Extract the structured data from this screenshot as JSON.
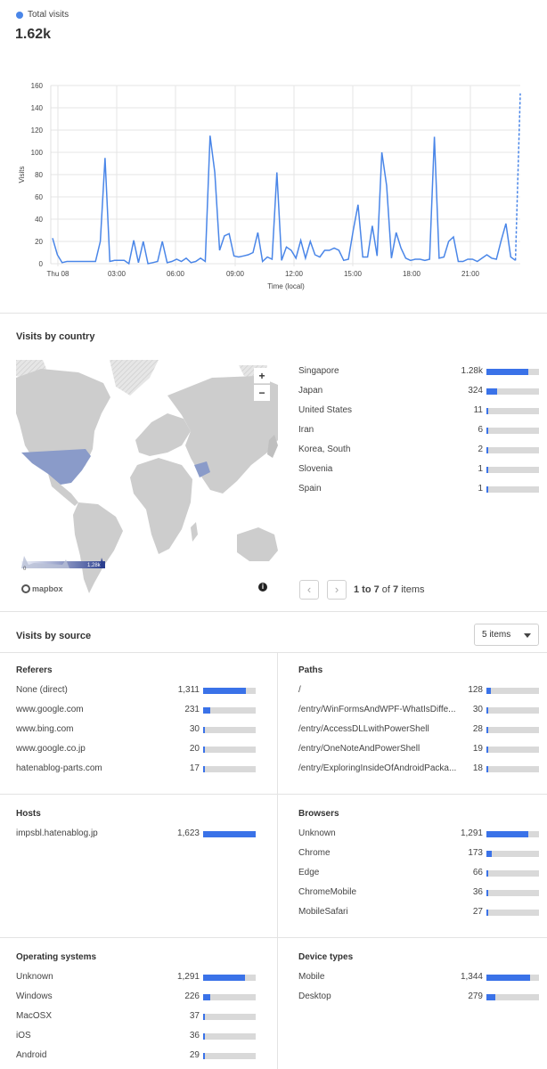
{
  "header": {
    "legend_label": "Total visits",
    "total": "1.62k",
    "accent": "#4a86e8"
  },
  "chart_data": {
    "type": "line",
    "title": "",
    "ylabel": "Visits",
    "xlabel": "Time (local)",
    "ylim": [
      0,
      160
    ],
    "yticks": [
      0,
      20,
      40,
      60,
      80,
      100,
      120,
      140,
      160
    ],
    "xticks": [
      "Thu 08",
      "03:00",
      "06:00",
      "09:00",
      "12:00",
      "15:00",
      "18:00",
      "21:00"
    ],
    "grid": true,
    "series": [
      {
        "name": "Total visits",
        "values": [
          23,
          8,
          1,
          2,
          2,
          2,
          2,
          2,
          2,
          2,
          20,
          95,
          2,
          3,
          3,
          3,
          0,
          21,
          1,
          20,
          0,
          1,
          2,
          20,
          1,
          2,
          4,
          2,
          5,
          1,
          2,
          5,
          2,
          115,
          82,
          12,
          25,
          27,
          7,
          6,
          7,
          8,
          10,
          28,
          2,
          6,
          4,
          82,
          3,
          15,
          12,
          5,
          21,
          5,
          20,
          8,
          6,
          12,
          12,
          14,
          12,
          3,
          4,
          30,
          53,
          6,
          6,
          34,
          7,
          100,
          70,
          5,
          28,
          14,
          5,
          3,
          4,
          4,
          3,
          4,
          114,
          5,
          6,
          20,
          24,
          2,
          2,
          4,
          4,
          2,
          5,
          8,
          5,
          4,
          21,
          36,
          6,
          3,
          153
        ]
      }
    ]
  },
  "country": {
    "title": "Visits by country",
    "rows": [
      {
        "label": "Singapore",
        "value": "1.28k",
        "ratio": 0.79
      },
      {
        "label": "Japan",
        "value": "324",
        "ratio": 0.2
      },
      {
        "label": "United States",
        "value": "11",
        "ratio": 0.01
      },
      {
        "label": "Iran",
        "value": "6",
        "ratio": 0.005
      },
      {
        "label": "Korea, South",
        "value": "2",
        "ratio": 0.002
      },
      {
        "label": "Slovenia",
        "value": "1",
        "ratio": 0.001
      },
      {
        "label": "Spain",
        "value": "1",
        "ratio": 0.001
      }
    ],
    "pager_range": "1 to 7",
    "pager_of": "of",
    "pager_total": "7",
    "pager_items": "items",
    "map": {
      "zoom_in": "+",
      "zoom_out": "−",
      "legend_min": "0",
      "legend_max": "1.28k",
      "brand": "mapbox",
      "info": "i"
    }
  },
  "source": {
    "title": "Visits by source",
    "select_value": "5 items",
    "referers": {
      "title": "Referers",
      "rows": [
        {
          "label": "None (direct)",
          "value": "1,311",
          "ratio": 0.81
        },
        {
          "label": "www.google.com",
          "value": "231",
          "ratio": 0.14
        },
        {
          "label": "www.bing.com",
          "value": "30",
          "ratio": 0.02
        },
        {
          "label": "www.google.co.jp",
          "value": "20",
          "ratio": 0.012
        },
        {
          "label": "hatenablog-parts.com",
          "value": "17",
          "ratio": 0.01
        }
      ]
    },
    "paths": {
      "title": "Paths",
      "rows": [
        {
          "label": "/",
          "value": "128",
          "ratio": 0.08
        },
        {
          "label": "/entry/WinFormsAndWPF-WhatIsDiffe...",
          "value": "30",
          "ratio": 0.02
        },
        {
          "label": "/entry/AccessDLLwithPowerShell",
          "value": "28",
          "ratio": 0.018
        },
        {
          "label": "/entry/OneNoteAndPowerShell",
          "value": "19",
          "ratio": 0.012
        },
        {
          "label": "/entry/ExploringInsideOfAndroidPacka...",
          "value": "18",
          "ratio": 0.011
        }
      ]
    },
    "hosts": {
      "title": "Hosts",
      "rows": [
        {
          "label": "impsbl.hatenablog.jp",
          "value": "1,623",
          "ratio": 1.0
        }
      ]
    },
    "browsers": {
      "title": "Browsers",
      "rows": [
        {
          "label": "Unknown",
          "value": "1,291",
          "ratio": 0.8
        },
        {
          "label": "Chrome",
          "value": "173",
          "ratio": 0.11
        },
        {
          "label": "Edge",
          "value": "66",
          "ratio": 0.04
        },
        {
          "label": "ChromeMobile",
          "value": "36",
          "ratio": 0.022
        },
        {
          "label": "MobileSafari",
          "value": "27",
          "ratio": 0.017
        }
      ]
    },
    "os": {
      "title": "Operating systems",
      "rows": [
        {
          "label": "Unknown",
          "value": "1,291",
          "ratio": 0.8
        },
        {
          "label": "Windows",
          "value": "226",
          "ratio": 0.14
        },
        {
          "label": "MacOSX",
          "value": "37",
          "ratio": 0.023
        },
        {
          "label": "iOS",
          "value": "36",
          "ratio": 0.022
        },
        {
          "label": "Android",
          "value": "29",
          "ratio": 0.018
        }
      ]
    },
    "devices": {
      "title": "Device types",
      "rows": [
        {
          "label": "Mobile",
          "value": "1,344",
          "ratio": 0.83
        },
        {
          "label": "Desktop",
          "value": "279",
          "ratio": 0.17
        }
      ]
    }
  }
}
